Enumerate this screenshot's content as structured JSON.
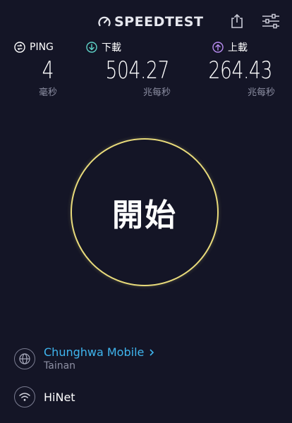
{
  "header": {
    "brand": "SPEEDTEST",
    "share_icon": "share-icon",
    "settings_icon": "sliders-icon"
  },
  "metrics": {
    "ping": {
      "label": "PING",
      "value": "4",
      "unit": "毫秒",
      "icon": "ping-icon",
      "color": "#ffffff"
    },
    "download": {
      "label": "下載",
      "value": "504.27",
      "unit": "兆每秒",
      "icon": "download-arrow-icon",
      "color": "#5fd3c8"
    },
    "upload": {
      "label": "上載",
      "value": "264.43",
      "unit": "兆每秒",
      "icon": "upload-arrow-icon",
      "color": "#b98cf2"
    }
  },
  "go_button": {
    "label": "開始",
    "ring_color": "#e9db7b"
  },
  "server": {
    "provider": "Chunghwa Mobile",
    "location": "Tainan",
    "icon": "globe-icon"
  },
  "connection": {
    "isp": "HiNet",
    "icon": "wifi-icon"
  },
  "colors": {
    "background": "#141526",
    "accent_link": "#3fb5ee",
    "muted_text": "#8d8fa3"
  }
}
